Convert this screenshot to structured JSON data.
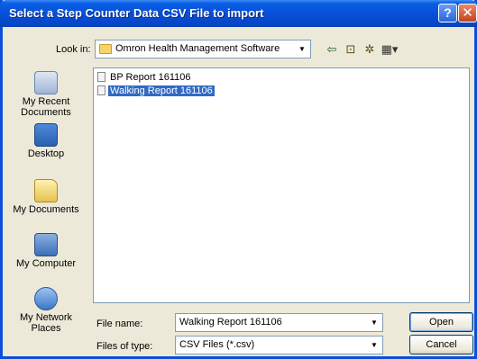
{
  "window": {
    "title": "Select a Step Counter Data CSV File to import",
    "help_glyph": "?",
    "close_glyph": "✕"
  },
  "look_in": {
    "label": "Look in:",
    "value": "Omron Health Management Software"
  },
  "toolbar": {
    "back_icon": "back-arrow-icon",
    "up_icon": "up-folder-icon",
    "new_folder_icon": "new-folder-icon",
    "views_icon": "views-menu-icon"
  },
  "places": [
    {
      "label": "My Recent Documents",
      "icon": "recent-documents-icon"
    },
    {
      "label": "Desktop",
      "icon": "desktop-icon"
    },
    {
      "label": "My Documents",
      "icon": "my-documents-icon"
    },
    {
      "label": "My Computer",
      "icon": "my-computer-icon"
    },
    {
      "label": "My Network Places",
      "icon": "network-places-icon"
    }
  ],
  "files": [
    {
      "name": "BP Report 161106",
      "selected": false
    },
    {
      "name": "Walking Report 161106",
      "selected": true
    }
  ],
  "file_name": {
    "label": "File name:",
    "value": "Walking Report 161106"
  },
  "file_type": {
    "label": "Files of type:",
    "value": "CSV Files (*.csv)"
  },
  "buttons": {
    "open": "Open",
    "cancel": "Cancel"
  },
  "colors": {
    "title_bar": "#0650d8",
    "selection": "#316ac5",
    "dialog_bg": "#ece9d8"
  }
}
